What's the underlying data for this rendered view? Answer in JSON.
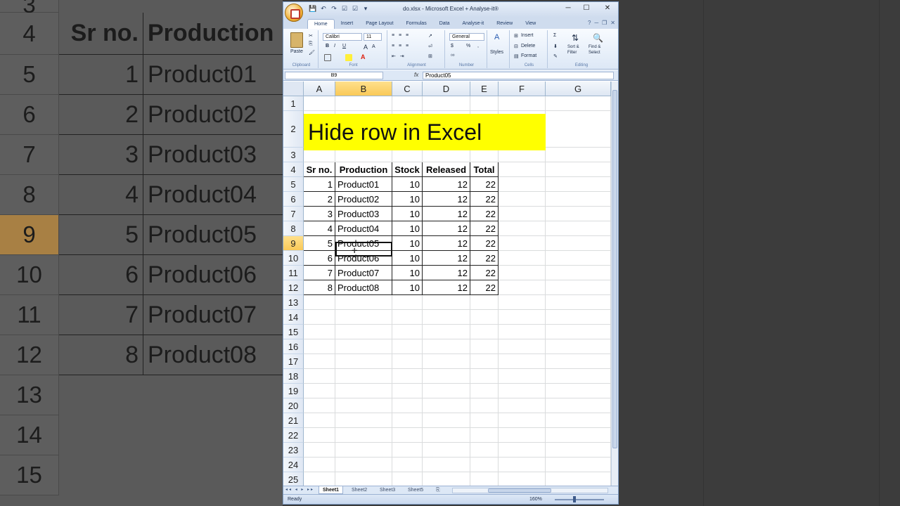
{
  "window": {
    "title": "do.xlsx - Microsoft Excel + Analyse-it®",
    "controls": {
      "minimize": "─",
      "maximize": "☐",
      "close": "✕"
    }
  },
  "ribbon_tabs": [
    "Home",
    "Insert",
    "Page Layout",
    "Formulas",
    "Data",
    "Analyse-it",
    "Review",
    "View"
  ],
  "ribbon": {
    "clipboard": {
      "label": "Clipboard",
      "paste": "Paste"
    },
    "font": {
      "label": "Font",
      "name": "Calibri",
      "size": "11",
      "bold": "B",
      "italic": "I",
      "underline": "U",
      "grow": "A",
      "shrink": "A"
    },
    "alignment": {
      "label": "Alignment"
    },
    "number": {
      "label": "Number",
      "format": "General",
      "currency": "$",
      "percent": "%"
    },
    "styles": {
      "label": "",
      "button": "Styles"
    },
    "cells": {
      "label": "Cells",
      "insert": "Insert",
      "delete": "Delete",
      "format": "Format"
    },
    "editing": {
      "label": "Editing",
      "sum": "Σ",
      "sort": "Sort &",
      "sort2": "Filter",
      "find": "Find &",
      "find2": "Select"
    }
  },
  "formula_bar": {
    "name_box": "B9",
    "fx": "fx",
    "content": "Product05"
  },
  "columns": [
    "A",
    "B",
    "C",
    "D",
    "E",
    "F",
    "G"
  ],
  "selected_column": "B",
  "rows": [
    "1",
    "2",
    "3",
    "4",
    "5",
    "6",
    "7",
    "8",
    "9",
    "10",
    "11",
    "12",
    "13",
    "14",
    "15",
    "16",
    "17",
    "18",
    "19",
    "20",
    "21",
    "22",
    "23",
    "24",
    "25"
  ],
  "selected_row": "9",
  "title_cell": "Hide row in Excel",
  "table": {
    "headers": [
      "Sr no.",
      "Production",
      "Stock",
      "Released",
      "Total"
    ],
    "rows": [
      [
        "1",
        "Product01",
        "10",
        "12",
        "22"
      ],
      [
        "2",
        "Product02",
        "10",
        "12",
        "22"
      ],
      [
        "3",
        "Product03",
        "10",
        "12",
        "22"
      ],
      [
        "4",
        "Product04",
        "10",
        "12",
        "22"
      ],
      [
        "5",
        "Product05",
        "10",
        "12",
        "22"
      ],
      [
        "6",
        "Product06",
        "10",
        "12",
        "22"
      ],
      [
        "7",
        "Product07",
        "10",
        "12",
        "22"
      ],
      [
        "8",
        "Product08",
        "10",
        "12",
        "22"
      ]
    ]
  },
  "sheets": [
    "Sheet1",
    "Sheet2",
    "Sheet3",
    "Sheet5"
  ],
  "active_sheet": "Sheet1",
  "status": {
    "text": "Ready",
    "zoom": "160%"
  },
  "background_zoom": {
    "rows": [
      "4",
      "5",
      "6",
      "7",
      "8",
      "9",
      "10",
      "11",
      "12",
      "13",
      "14",
      "15"
    ],
    "header_srno": "Sr no.",
    "header_prod": "Production",
    "srno": [
      "1",
      "2",
      "3",
      "4",
      "5",
      "6",
      "7",
      "8"
    ],
    "prod": [
      "Product01",
      "Product02",
      "Product03",
      "Product04",
      "Product05",
      "Product06",
      "Product07",
      "Product08"
    ]
  },
  "colors": {
    "title_fill": "#ffff00",
    "selected_header": "#f9c958",
    "window_border": "#7d9cc3"
  }
}
